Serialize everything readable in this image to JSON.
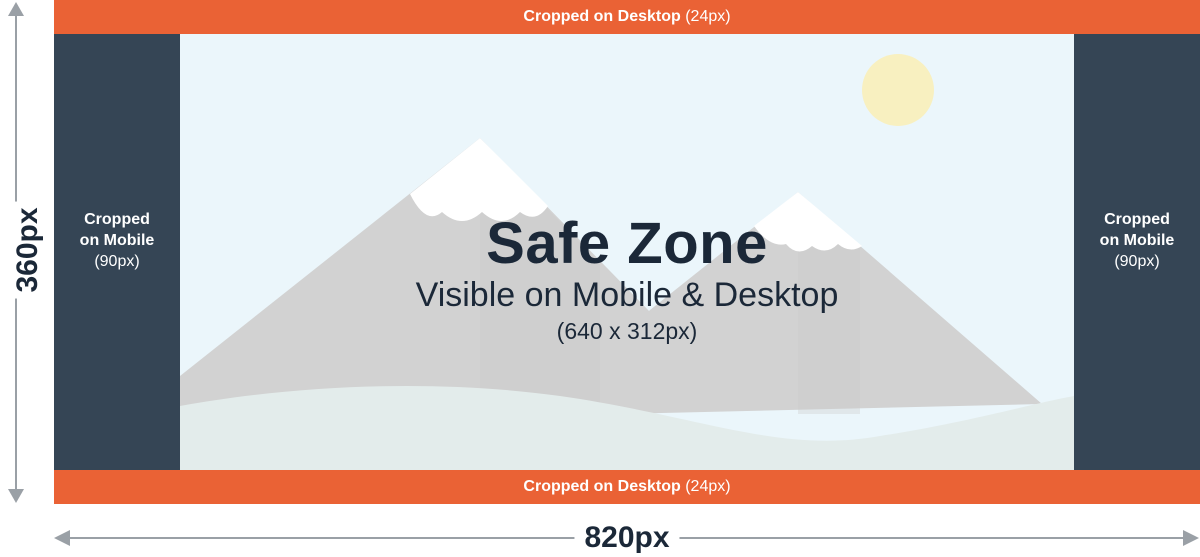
{
  "top_bar": {
    "label_bold": "Cropped on Desktop",
    "label_value": "(24px)"
  },
  "bottom_bar": {
    "label_bold": "Cropped on Desktop",
    "label_value": "(24px)"
  },
  "left_side": {
    "line1": "Cropped",
    "line2": "on Mobile",
    "value": "(90px)"
  },
  "right_side": {
    "line1": "Cropped",
    "line2": "on Mobile",
    "value": "(90px)"
  },
  "safe_zone": {
    "title": "Safe Zone",
    "subtitle": "Visible on Mobile & Desktop",
    "dimensions": "(640 x 312px)"
  },
  "height_label": "360px",
  "width_label": "820px",
  "colors": {
    "crop_desktop": "#ea6235",
    "crop_mobile": "#354555",
    "sky": "#ebf6fb",
    "mountain": "#d2d2d2",
    "snow": "#ffffff",
    "ground": "#e3eceb",
    "sun": "#f8f0c0",
    "text": "#1b2838",
    "arrow": "#9aa0a6"
  },
  "icons": [
    "sun-icon",
    "mountain-illustration",
    "arrow-up-icon",
    "arrow-down-icon",
    "arrow-left-icon",
    "arrow-right-icon"
  ]
}
